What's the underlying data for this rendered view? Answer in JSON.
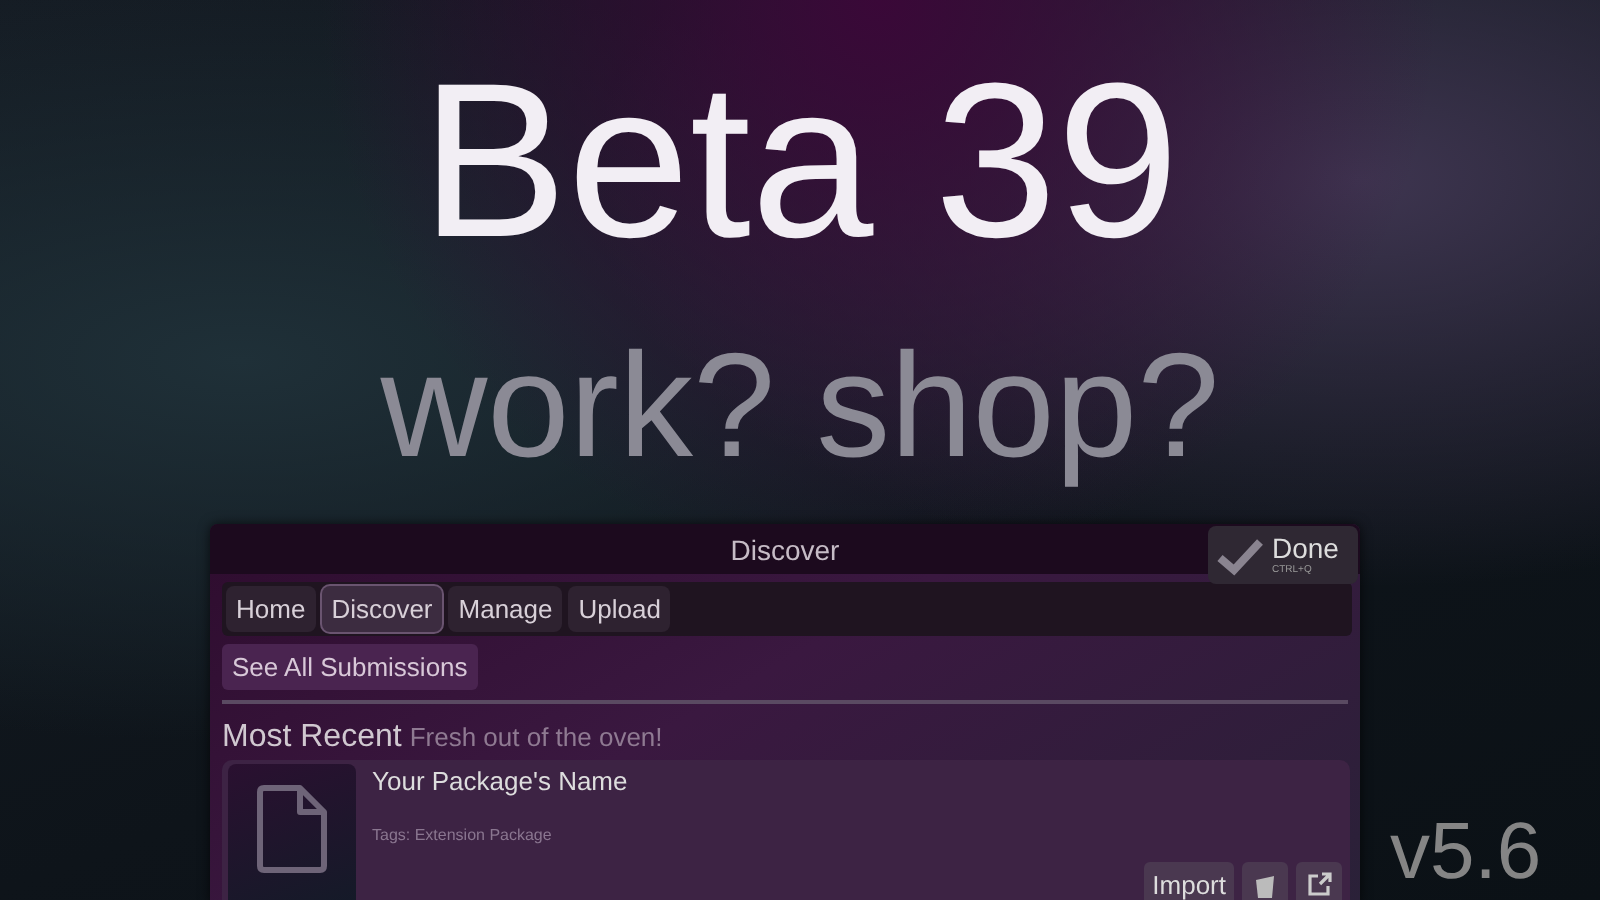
{
  "headline": "Beta 39",
  "subheadline": "work? shop?",
  "version": "v5.6",
  "window": {
    "title": "Discover",
    "done_button": {
      "label": "Done",
      "shortcut": "CTRL+Q"
    }
  },
  "tabs": [
    {
      "label": "Home",
      "selected": false
    },
    {
      "label": "Discover",
      "selected": true
    },
    {
      "label": "Manage",
      "selected": false
    },
    {
      "label": "Upload",
      "selected": false
    }
  ],
  "see_all_button": "See All Submissions",
  "section": {
    "title": "Most Recent",
    "subtitle": "Fresh out of the oven!"
  },
  "packages": [
    {
      "name": "Your Package's Name",
      "tags": "Tags: Extension Package",
      "import_button": "Import"
    }
  ]
}
